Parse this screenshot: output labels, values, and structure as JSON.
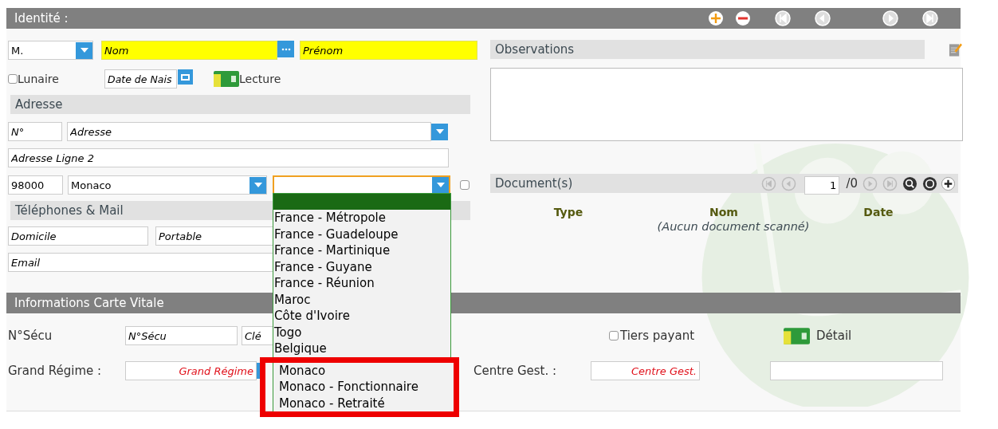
{
  "header": {
    "title": "Identité :"
  },
  "identity": {
    "civility": "M.",
    "nom": {
      "placeholder": "Nom"
    },
    "prenom": {
      "placeholder": "Prénom"
    },
    "lunaire": {
      "label": "Lunaire",
      "checked": false
    },
    "birth_date": {
      "placeholder": "Date de Nais"
    },
    "card_reader": {
      "label": "Lecture"
    }
  },
  "address": {
    "title": "Adresse",
    "number": {
      "placeholder": "N°"
    },
    "street": {
      "placeholder": "Adresse"
    },
    "line2": {
      "placeholder": "Adresse Ligne 2"
    },
    "postcode": "98000",
    "city": "Monaco",
    "country_select": {
      "open": true
    },
    "extra_checkbox": {
      "checked": false
    }
  },
  "dropdown": {
    "options": [
      {
        "label": "France - Métropole",
        "selected": false,
        "highlighted": false
      },
      {
        "label": "France - Guadeloupe",
        "selected": false,
        "highlighted": false
      },
      {
        "label": "France - Martinique",
        "selected": false,
        "highlighted": false
      },
      {
        "label": "France - Guyane",
        "selected": false,
        "highlighted": false
      },
      {
        "label": "France - Réunion",
        "selected": false,
        "highlighted": false
      },
      {
        "label": "Maroc",
        "selected": false,
        "highlighted": false
      },
      {
        "label": "Côte d'Ivoire",
        "selected": false,
        "highlighted": false
      },
      {
        "label": "Togo",
        "selected": false,
        "highlighted": false
      },
      {
        "label": "Belgique",
        "selected": false,
        "highlighted": false
      },
      {
        "label": "Monaco",
        "selected": false,
        "highlighted": true
      },
      {
        "label": "Monaco - Fonctionnaire",
        "selected": false,
        "highlighted": true
      },
      {
        "label": "Monaco - Retraité",
        "selected": false,
        "highlighted": true
      }
    ]
  },
  "phones": {
    "title": "Téléphones & Mail",
    "home": {
      "placeholder": "Domicile"
    },
    "mobile": {
      "placeholder": "Portable"
    },
    "email": {
      "placeholder": "Email"
    }
  },
  "observations": {
    "title": "Observations"
  },
  "documents": {
    "title": "Document(s)",
    "page": "1",
    "total": "/0",
    "columns": [
      "Type",
      "Nom",
      "Date"
    ],
    "empty_text": "(Aucun document scanné)"
  },
  "carte_vitale": {
    "title": "Informations Carte Vitale",
    "secu_label": "N°Sécu",
    "secu": {
      "placeholder": "N°Sécu"
    },
    "cle": {
      "placeholder": "Clé"
    },
    "tiers_payant": {
      "label": "Tiers payant",
      "checked": false
    },
    "detail": {
      "label": "Détail"
    },
    "regime_label": "Grand Régime :",
    "regime": {
      "placeholder": "Grand Régime"
    },
    "centre_label": "Centre Gest. :",
    "centre": {
      "placeholder": "Centre Gest."
    }
  }
}
